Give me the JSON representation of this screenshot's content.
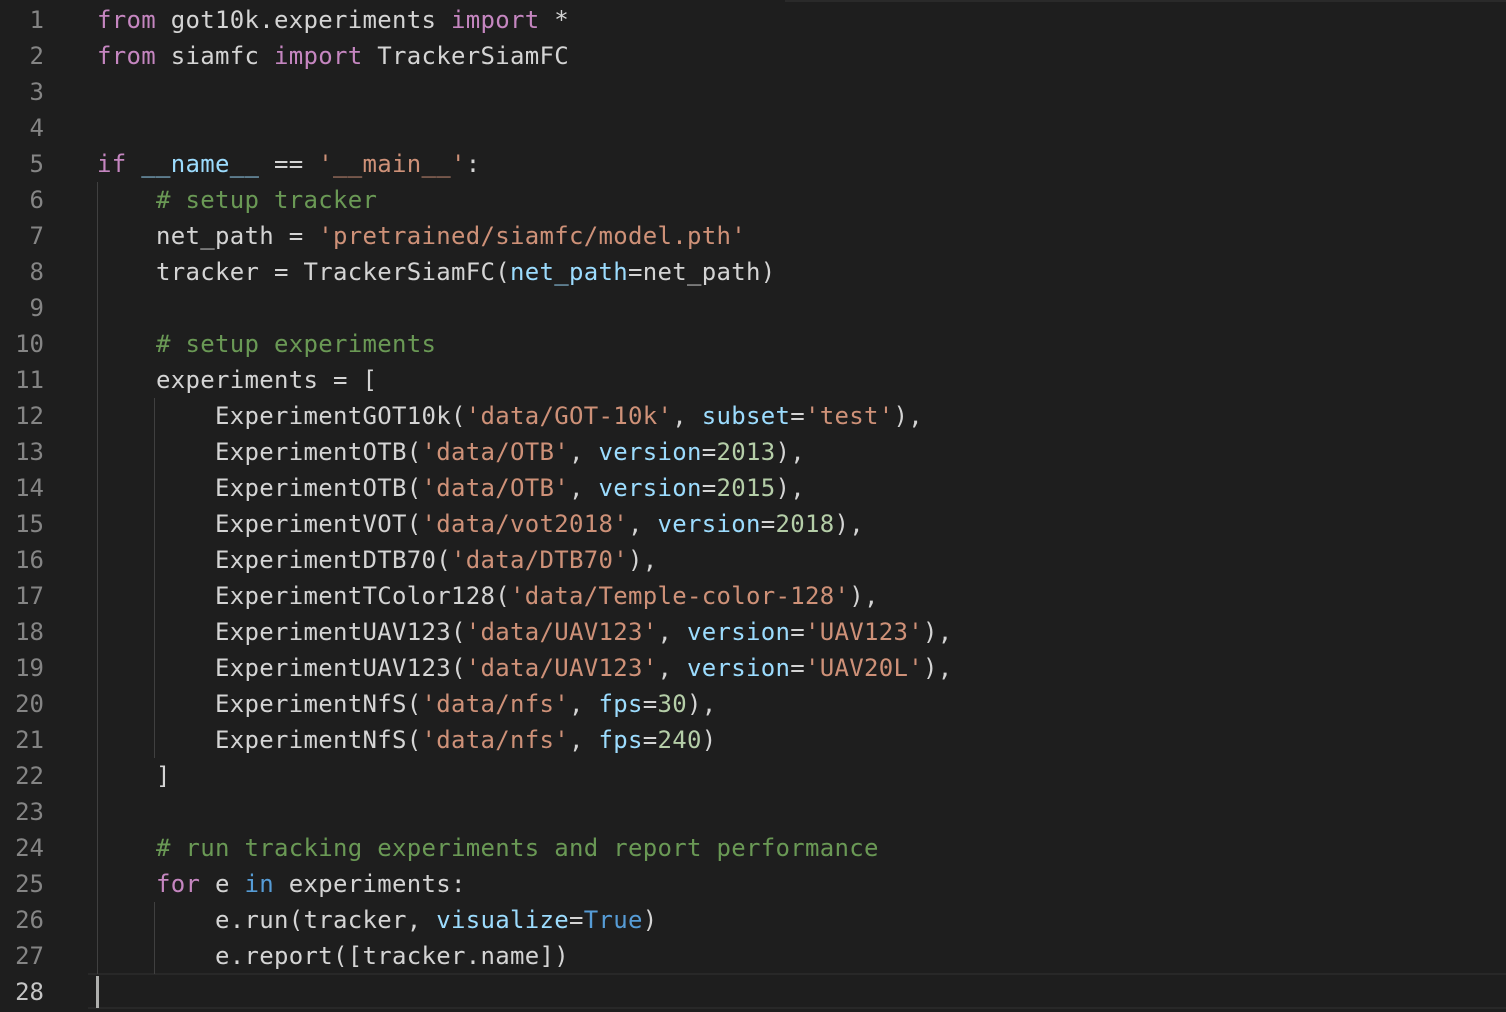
{
  "editor": {
    "active_line": 28,
    "lines": [
      {
        "n": "1",
        "tokens": [
          {
            "t": "from",
            "c": "k"
          },
          {
            "t": " got10k.experiments ",
            "c": "t"
          },
          {
            "t": "import",
            "c": "k"
          },
          {
            "t": " *",
            "c": "t"
          }
        ]
      },
      {
        "n": "2",
        "tokens": [
          {
            "t": "from",
            "c": "k"
          },
          {
            "t": " siamfc ",
            "c": "t"
          },
          {
            "t": "import",
            "c": "k"
          },
          {
            "t": " TrackerSiamFC",
            "c": "t"
          }
        ]
      },
      {
        "n": "3",
        "tokens": []
      },
      {
        "n": "4",
        "tokens": []
      },
      {
        "n": "5",
        "tokens": [
          {
            "t": "if",
            "c": "k"
          },
          {
            "t": " ",
            "c": "t"
          },
          {
            "t": "__name__",
            "c": "v"
          },
          {
            "t": " == ",
            "c": "t"
          },
          {
            "t": "'__main__'",
            "c": "s"
          },
          {
            "t": ":",
            "c": "t"
          }
        ]
      },
      {
        "n": "6",
        "tokens": [
          {
            "t": "    ",
            "c": "t"
          },
          {
            "t": "# setup tracker",
            "c": "c"
          }
        ]
      },
      {
        "n": "7",
        "tokens": [
          {
            "t": "    net_path = ",
            "c": "t"
          },
          {
            "t": "'pretrained/siamfc/model.pth'",
            "c": "s"
          }
        ]
      },
      {
        "n": "8",
        "tokens": [
          {
            "t": "    tracker = TrackerSiamFC(",
            "c": "t"
          },
          {
            "t": "net_path",
            "c": "v"
          },
          {
            "t": "=net_path)",
            "c": "t"
          }
        ]
      },
      {
        "n": "9",
        "tokens": []
      },
      {
        "n": "10",
        "tokens": [
          {
            "t": "    ",
            "c": "t"
          },
          {
            "t": "# setup experiments",
            "c": "c"
          }
        ]
      },
      {
        "n": "11",
        "tokens": [
          {
            "t": "    experiments = [",
            "c": "t"
          }
        ]
      },
      {
        "n": "12",
        "tokens": [
          {
            "t": "        ExperimentGOT10k(",
            "c": "t"
          },
          {
            "t": "'data/GOT-10k'",
            "c": "s"
          },
          {
            "t": ", ",
            "c": "t"
          },
          {
            "t": "subset",
            "c": "v"
          },
          {
            "t": "=",
            "c": "t"
          },
          {
            "t": "'test'",
            "c": "s"
          },
          {
            "t": "),",
            "c": "t"
          }
        ]
      },
      {
        "n": "13",
        "tokens": [
          {
            "t": "        ExperimentOTB(",
            "c": "t"
          },
          {
            "t": "'data/OTB'",
            "c": "s"
          },
          {
            "t": ", ",
            "c": "t"
          },
          {
            "t": "version",
            "c": "v"
          },
          {
            "t": "=",
            "c": "t"
          },
          {
            "t": "2013",
            "c": "n"
          },
          {
            "t": "),",
            "c": "t"
          }
        ]
      },
      {
        "n": "14",
        "tokens": [
          {
            "t": "        ExperimentOTB(",
            "c": "t"
          },
          {
            "t": "'data/OTB'",
            "c": "s"
          },
          {
            "t": ", ",
            "c": "t"
          },
          {
            "t": "version",
            "c": "v"
          },
          {
            "t": "=",
            "c": "t"
          },
          {
            "t": "2015",
            "c": "n"
          },
          {
            "t": "),",
            "c": "t"
          }
        ]
      },
      {
        "n": "15",
        "tokens": [
          {
            "t": "        ExperimentVOT(",
            "c": "t"
          },
          {
            "t": "'data/vot2018'",
            "c": "s"
          },
          {
            "t": ", ",
            "c": "t"
          },
          {
            "t": "version",
            "c": "v"
          },
          {
            "t": "=",
            "c": "t"
          },
          {
            "t": "2018",
            "c": "n"
          },
          {
            "t": "),",
            "c": "t"
          }
        ]
      },
      {
        "n": "16",
        "tokens": [
          {
            "t": "        ExperimentDTB70(",
            "c": "t"
          },
          {
            "t": "'data/DTB70'",
            "c": "s"
          },
          {
            "t": "),",
            "c": "t"
          }
        ]
      },
      {
        "n": "17",
        "tokens": [
          {
            "t": "        ExperimentTColor128(",
            "c": "t"
          },
          {
            "t": "'data/Temple-color-128'",
            "c": "s"
          },
          {
            "t": "),",
            "c": "t"
          }
        ]
      },
      {
        "n": "18",
        "tokens": [
          {
            "t": "        ExperimentUAV123(",
            "c": "t"
          },
          {
            "t": "'data/UAV123'",
            "c": "s"
          },
          {
            "t": ", ",
            "c": "t"
          },
          {
            "t": "version",
            "c": "v"
          },
          {
            "t": "=",
            "c": "t"
          },
          {
            "t": "'UAV123'",
            "c": "s"
          },
          {
            "t": "),",
            "c": "t"
          }
        ]
      },
      {
        "n": "19",
        "tokens": [
          {
            "t": "        ExperimentUAV123(",
            "c": "t"
          },
          {
            "t": "'data/UAV123'",
            "c": "s"
          },
          {
            "t": ", ",
            "c": "t"
          },
          {
            "t": "version",
            "c": "v"
          },
          {
            "t": "=",
            "c": "t"
          },
          {
            "t": "'UAV20L'",
            "c": "s"
          },
          {
            "t": "),",
            "c": "t"
          }
        ]
      },
      {
        "n": "20",
        "tokens": [
          {
            "t": "        ExperimentNfS(",
            "c": "t"
          },
          {
            "t": "'data/nfs'",
            "c": "s"
          },
          {
            "t": ", ",
            "c": "t"
          },
          {
            "t": "fps",
            "c": "v"
          },
          {
            "t": "=",
            "c": "t"
          },
          {
            "t": "30",
            "c": "n"
          },
          {
            "t": "),",
            "c": "t"
          }
        ]
      },
      {
        "n": "21",
        "tokens": [
          {
            "t": "        ExperimentNfS(",
            "c": "t"
          },
          {
            "t": "'data/nfs'",
            "c": "s"
          },
          {
            "t": ", ",
            "c": "t"
          },
          {
            "t": "fps",
            "c": "v"
          },
          {
            "t": "=",
            "c": "t"
          },
          {
            "t": "240",
            "c": "n"
          },
          {
            "t": ")",
            "c": "t"
          }
        ]
      },
      {
        "n": "22",
        "tokens": [
          {
            "t": "    ]",
            "c": "t"
          }
        ]
      },
      {
        "n": "23",
        "tokens": []
      },
      {
        "n": "24",
        "tokens": [
          {
            "t": "    ",
            "c": "t"
          },
          {
            "t": "# run tracking experiments and report performance",
            "c": "c"
          }
        ]
      },
      {
        "n": "25",
        "tokens": [
          {
            "t": "    ",
            "c": "t"
          },
          {
            "t": "for",
            "c": "k"
          },
          {
            "t": " e ",
            "c": "t"
          },
          {
            "t": "in",
            "c": "b"
          },
          {
            "t": " experiments:",
            "c": "t"
          }
        ]
      },
      {
        "n": "26",
        "tokens": [
          {
            "t": "        e.run(tracker, ",
            "c": "t"
          },
          {
            "t": "visualize",
            "c": "v"
          },
          {
            "t": "=",
            "c": "t"
          },
          {
            "t": "True",
            "c": "b"
          },
          {
            "t": ")",
            "c": "t"
          }
        ]
      },
      {
        "n": "27",
        "tokens": [
          {
            "t": "        e.report([tracker.name])",
            "c": "t"
          }
        ]
      },
      {
        "n": "28",
        "tokens": []
      }
    ]
  }
}
